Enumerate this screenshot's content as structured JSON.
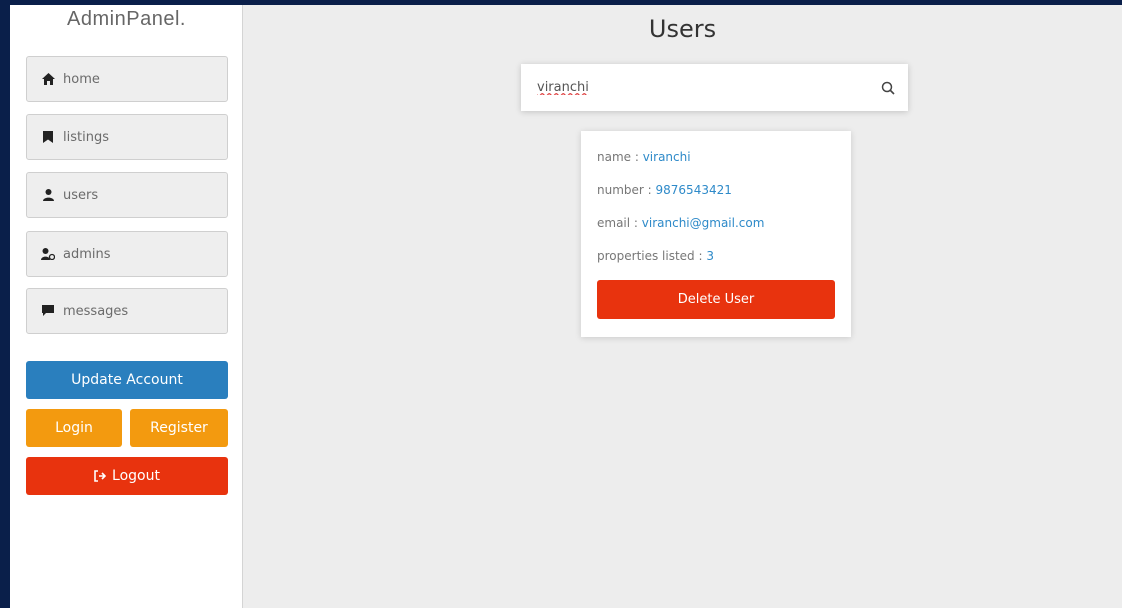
{
  "app": {
    "title": "AdminPanel."
  },
  "sidebar": {
    "items": [
      {
        "label": "home",
        "icon": "home-icon"
      },
      {
        "label": "listings",
        "icon": "bookmark-icon"
      },
      {
        "label": "users",
        "icon": "user-icon"
      },
      {
        "label": "admins",
        "icon": "user-gear-icon"
      },
      {
        "label": "messages",
        "icon": "message-icon"
      }
    ],
    "update_label": "Update Account",
    "login_label": "Login",
    "register_label": "Register",
    "logout_label": "Logout"
  },
  "main": {
    "title": "Users",
    "search": {
      "value": "viranchi",
      "icon": "search-icon"
    },
    "user_card": {
      "name_label": "name : ",
      "name_value": "viranchi",
      "number_label": "number : ",
      "number_value": "9876543421",
      "email_label": "email : ",
      "email_value": "viranchi@gmail.com",
      "properties_label": "properties listed : ",
      "properties_value": "3",
      "delete_label": "Delete User"
    }
  },
  "colors": {
    "background_border": "#0a1f4a",
    "primary_blue": "#2a7fbe",
    "warning_orange": "#f39a0f",
    "danger_red": "#e8330e",
    "link_blue": "#2e8ac9"
  }
}
